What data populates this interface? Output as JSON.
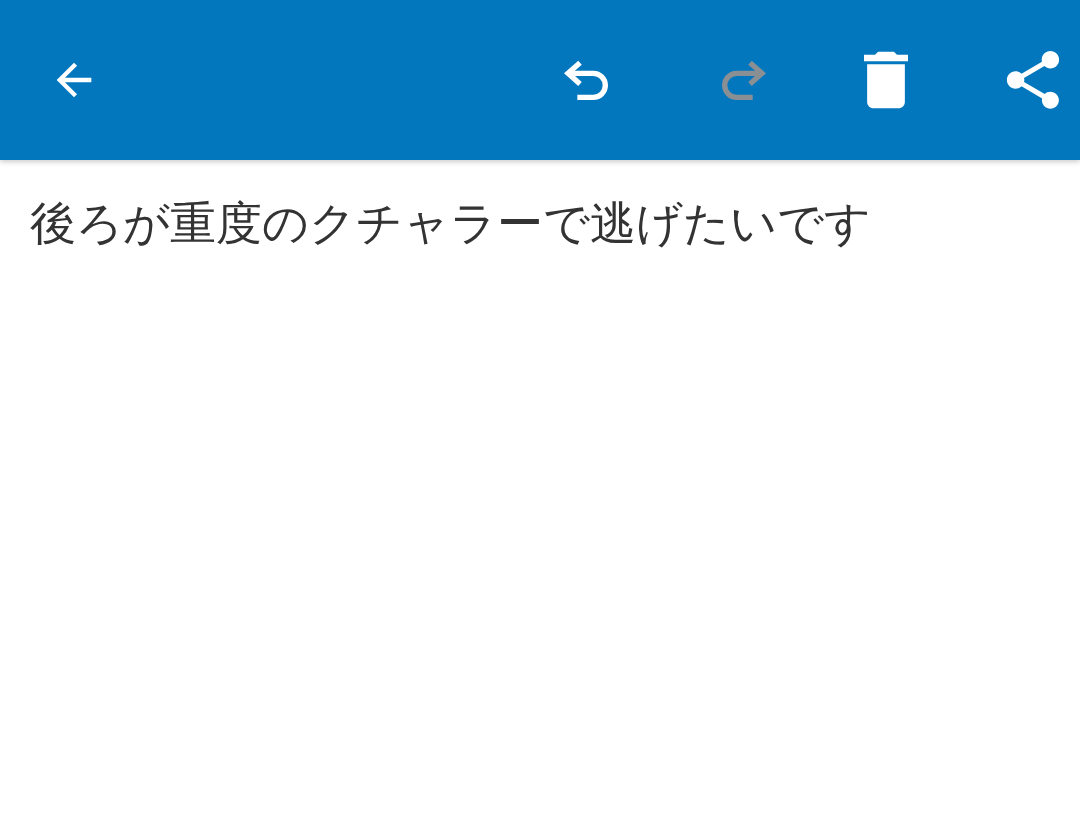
{
  "toolbar": {
    "actions": [
      {
        "kind": "back",
        "disabled": false
      },
      {
        "kind": "undo",
        "disabled": false
      },
      {
        "kind": "redo",
        "disabled": true
      },
      {
        "kind": "delete",
        "disabled": false
      },
      {
        "kind": "share",
        "disabled": false
      }
    ]
  },
  "note": {
    "text": "後ろが重度のクチャラーで逃げたいです"
  }
}
